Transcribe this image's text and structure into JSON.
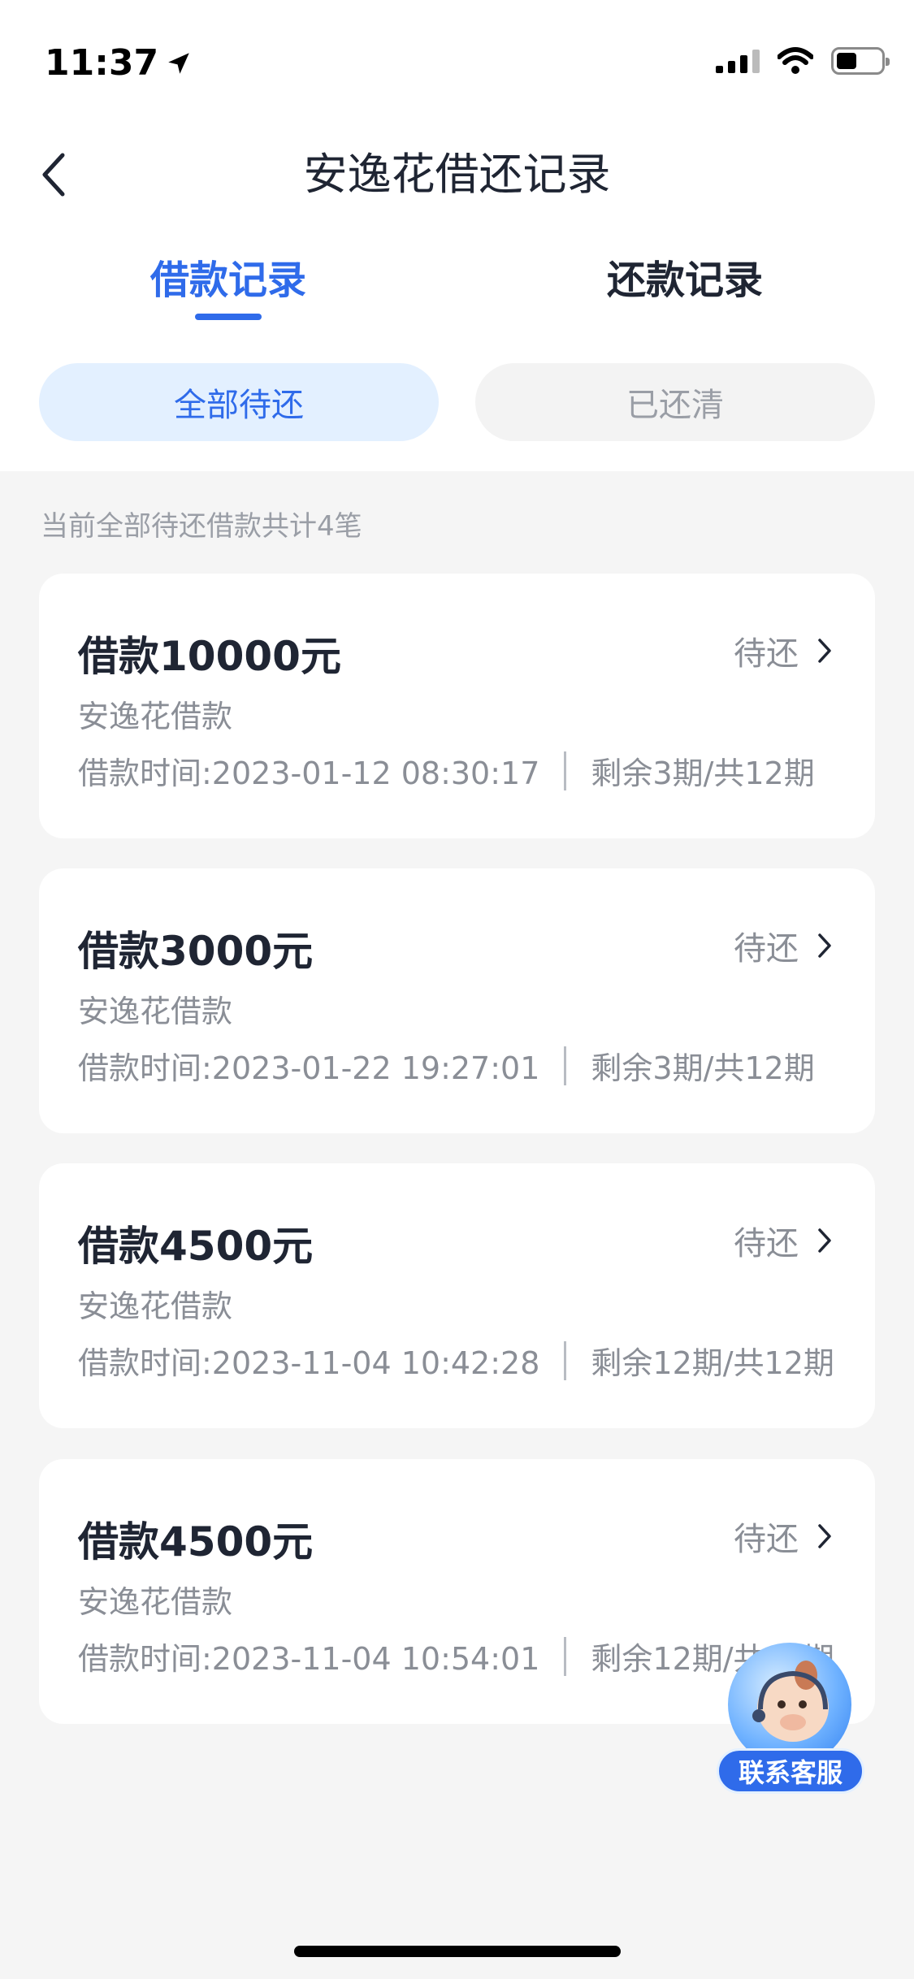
{
  "status_bar": {
    "time": "11:37"
  },
  "header": {
    "title": "安逸花借还记录"
  },
  "tabs": [
    {
      "label": "借款记录",
      "active": true
    },
    {
      "label": "还款记录",
      "active": false
    }
  ],
  "filters": [
    {
      "label": "全部待还",
      "active": true
    },
    {
      "label": "已还清",
      "active": false
    }
  ],
  "summary": "当前全部待还借款共计4笔",
  "loans": [
    {
      "amount": "借款10000元",
      "status": "待还",
      "product": "安逸花借款",
      "time": "借款时间:2023-01-12 08:30:17",
      "periods": "剩余3期/共12期"
    },
    {
      "amount": "借款3000元",
      "status": "待还",
      "product": "安逸花借款",
      "time": "借款时间:2023-01-22 19:27:01",
      "periods": "剩余3期/共12期"
    },
    {
      "amount": "借款4500元",
      "status": "待还",
      "product": "安逸花借款",
      "time": "借款时间:2023-11-04 10:42:28",
      "periods": "剩余12期/共12期"
    },
    {
      "amount": "借款4500元",
      "status": "待还",
      "product": "安逸花借款",
      "time": "借款时间:2023-11-04 10:54:01",
      "periods": "剩余12期/共12期"
    }
  ],
  "customer_service": {
    "label": "联系客服"
  },
  "colors": {
    "accent": "#2f6bea",
    "pill_active_bg": "#e3f0ff",
    "page_bg": "#f5f5f5"
  }
}
